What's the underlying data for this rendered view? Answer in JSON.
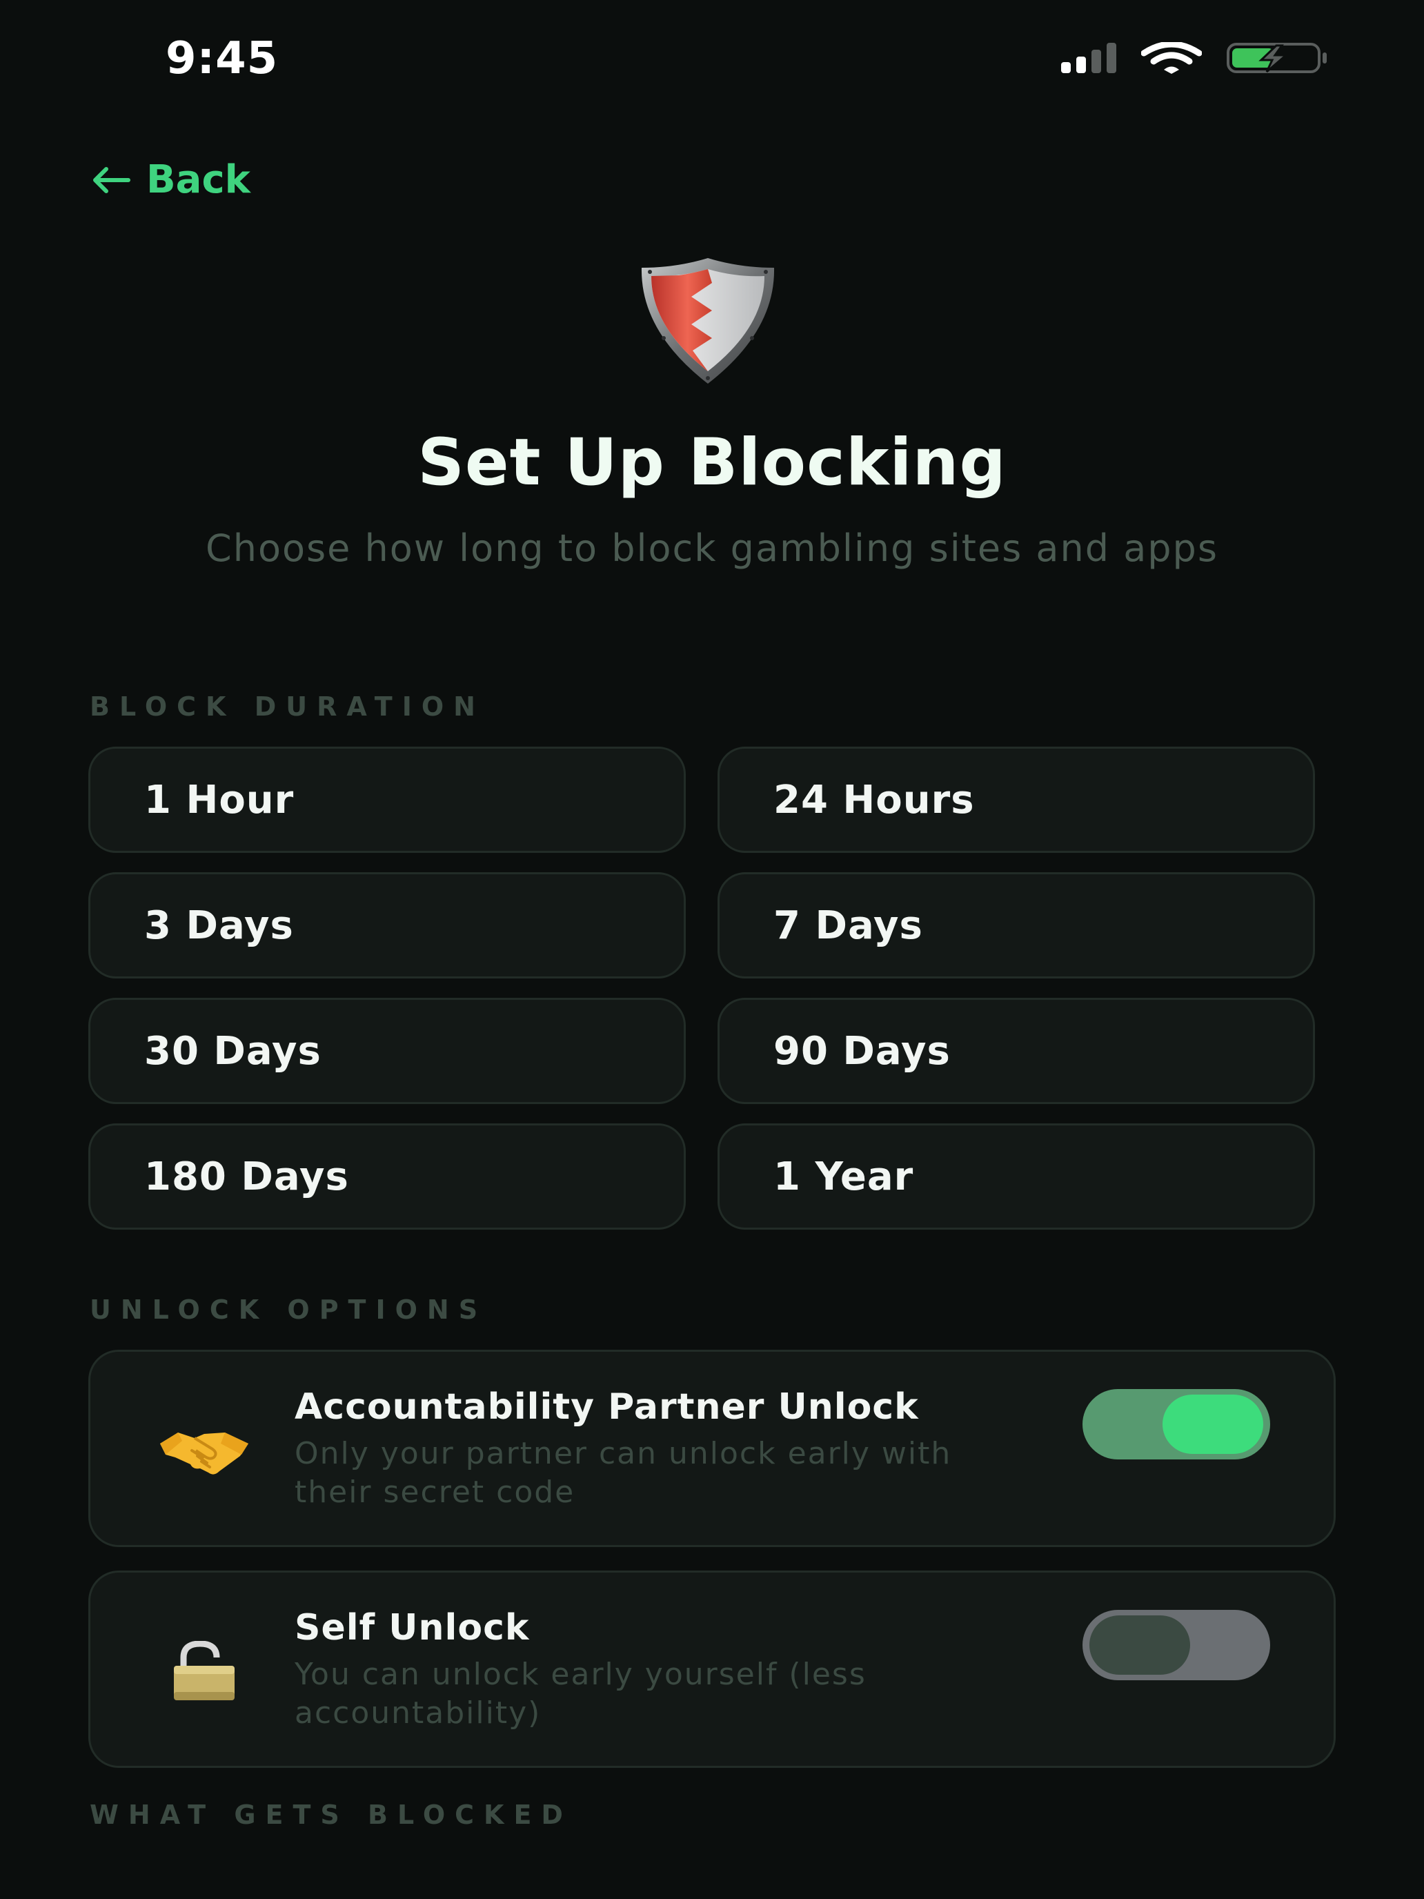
{
  "status_bar": {
    "time": "9:45"
  },
  "nav": {
    "back_label": "Back"
  },
  "header": {
    "title": "Set Up Blocking",
    "subtitle": "Choose how long to block gambling sites and apps"
  },
  "block_duration": {
    "section_label": "BLOCK DURATION",
    "options": [
      "1 Hour",
      "24 Hours",
      "3 Days",
      "7 Days",
      "30 Days",
      "90 Days",
      "180 Days",
      "1 Year"
    ]
  },
  "unlock_options": {
    "section_label": "UNLOCK OPTIONS",
    "items": [
      {
        "icon": "handshake-icon",
        "title": "Accountability Partner Unlock",
        "description": "Only your partner can unlock early with their secret code",
        "enabled": true
      },
      {
        "icon": "unlocked-padlock-icon",
        "title": "Self Unlock",
        "description": "You can unlock early yourself (less accountability)",
        "enabled": false
      }
    ]
  },
  "what_gets_blocked": {
    "section_label": "WHAT GETS BLOCKED"
  },
  "colors": {
    "accent": "#3fd37f",
    "background": "#0b0e0d",
    "card": "#131816"
  }
}
